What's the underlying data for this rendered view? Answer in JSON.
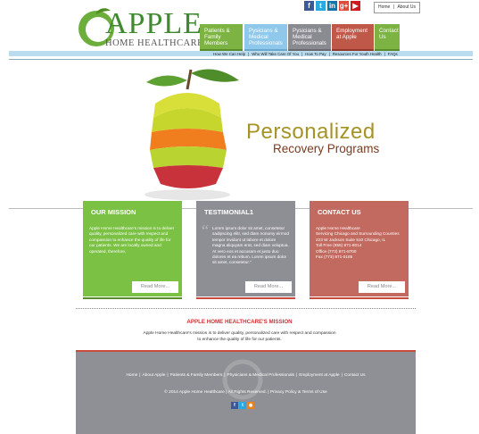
{
  "brand": {
    "title": "APPLE",
    "subtitle": "HOME HEALTHCARE",
    "accent": "#3f8a2f"
  },
  "social": [
    {
      "icon": "facebook-icon",
      "glyph": "f",
      "color": "#3b5998"
    },
    {
      "icon": "twitter-icon",
      "glyph": "t",
      "color": "#2aa9e0"
    },
    {
      "icon": "linkedin-icon",
      "glyph": "in",
      "color": "#0e76a8"
    },
    {
      "icon": "googleplus-icon",
      "glyph": "g+",
      "color": "#dd4b39"
    },
    {
      "icon": "youtube-icon",
      "glyph": "▶",
      "color": "#cc181e"
    }
  ],
  "toplinks": {
    "home": "Home",
    "sep": "|",
    "about": "About Us"
  },
  "nav": {
    "tabs": [
      {
        "label": "Patients & Family Members",
        "color": "#7cb342",
        "edge": "#5a8c2a"
      },
      {
        "label": "Pysicians & Medical Professionals",
        "color": "#8fc8ea",
        "edge": "#6aa8cd"
      },
      {
        "label": "Pysicians & Medical Professionals",
        "color": "#8a8a91",
        "edge": "#6a6a70"
      },
      {
        "label": "Employment at Apple",
        "color": "#c0584a",
        "edge": "#96392d"
      },
      {
        "label": "Contact Us",
        "color": "#7cb342",
        "edge": "#5a8c2a"
      }
    ],
    "subnav": [
      "How We Can Help",
      "|",
      "Who Will Take Care Of You",
      "|",
      "How To Pay",
      "|",
      "Resources For Youth Health",
      "|",
      "FAQs"
    ]
  },
  "hero": {
    "title": "Personalized",
    "subtitle": "Recovery Programs",
    "title_color": "#a59325",
    "subtitle_color": "#7a3a20"
  },
  "boxes": [
    {
      "title": "OUR MISSION",
      "color": "#7bc143",
      "stripe": "#5a8c2a",
      "text": "Apple Home Healthcare's mission is to deliver quality, personalized care with respect and compassion to enhance the quality of life for our patients. We are locally owned and operated, therefore,",
      "button": "Read More..."
    },
    {
      "title": "TESTIMONIAL1",
      "color": "#8e8e95",
      "stripe": "#c94b3c",
      "text": "Lorem ipsum dolor sit amet, consetetur sadipscing elitr, sed diam nonumy eirmod tempor invidunt ut labore et dolore magna aliquyam erat, sed diam voluptua. At vero eos et accusam et justo duo dolores et ea rebum. Lorem ipsum dolor sit amet, consetetur.\"",
      "button": "Read More..."
    },
    {
      "title": "CONTACT US",
      "color": "#c26a5f",
      "stripe": "#c94b3c",
      "lines": [
        "Apple Home Healthcare",
        "Servicing Chicago and Surrounding Counties",
        "223 W Jackson Suite 510 Chicago, IL",
        "Toll Free (855) 871-8014",
        "Office (773) 871-8700",
        "Fax (773) 871-0185"
      ],
      "button": "Read More..."
    }
  ],
  "mission": {
    "title": "APPLE HOME HEALTHCARE'S MISSION",
    "text": "Apple Home Healthcare's mission is to deliver quality, personalized care with respect and compassion to enhance the quality of life for our patients."
  },
  "footer": {
    "links": [
      "Home",
      "|",
      "About Apple",
      "|",
      "Patients & Family Members",
      "|",
      "Physicians & Medical Professionals",
      "|",
      "Employment at Apple",
      "|",
      "Contact Us"
    ],
    "copyright": "© 2014 Apple Home Healthcare  |  All Rights Reserved.  |  Privacy Policy & Terms of Use",
    "social": [
      {
        "icon": "facebook-icon",
        "glyph": "f",
        "color": "#3b5998"
      },
      {
        "icon": "twitter-icon",
        "glyph": "t",
        "color": "#2aa9e0"
      },
      {
        "icon": "rss-icon",
        "glyph": "◉",
        "color": "#e8831f"
      }
    ]
  }
}
